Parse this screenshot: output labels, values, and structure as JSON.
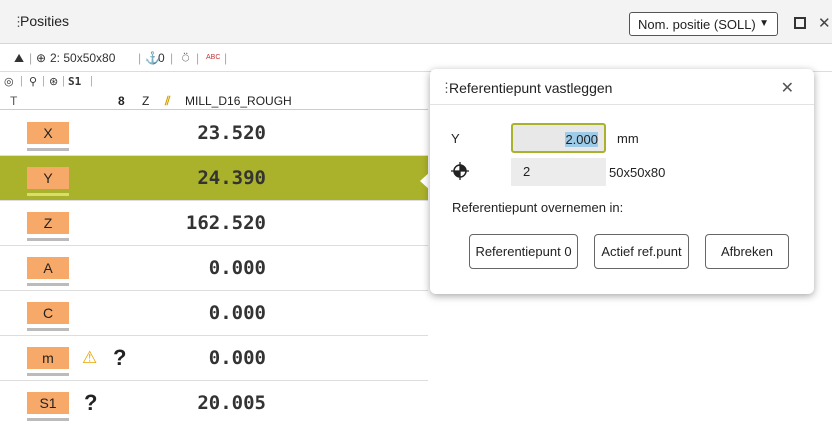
{
  "window": {
    "title": "Posities",
    "view_select": "Nom. positie (SOLL)"
  },
  "toolbar1": {
    "workpiece": "2: 50x50x80",
    "preset": "0",
    "abc": "ABC"
  },
  "toolbar2": {
    "spindle": "S1"
  },
  "header": {
    "col_t": "T",
    "tool_number": "8",
    "axis": "Z",
    "tool_name": "MILL_D16_ROUGH"
  },
  "rows": [
    {
      "axis": "X",
      "value": "23.520"
    },
    {
      "axis": "Y",
      "value": "24.390"
    },
    {
      "axis": "Z",
      "value": "162.520"
    },
    {
      "axis": "A",
      "value": "0.000"
    },
    {
      "axis": "C",
      "value": "0.000"
    },
    {
      "axis": "m",
      "value": "0.000",
      "marker": "?"
    },
    {
      "axis": "S1",
      "value": "20.005",
      "marker": "?"
    }
  ],
  "dialog": {
    "title": "Referentiepunt vastleggen",
    "axis_label": "Y",
    "input_value": "2.000",
    "unit": "mm",
    "preset_number": "2",
    "preset_name": "50x50x80",
    "apply_label": "Referentiepunt overnemen in:",
    "buttons": {
      "ref0": "Referentiepunt 0",
      "active": "Actief ref.punt",
      "cancel": "Afbreken"
    }
  },
  "colors": {
    "accent": "#aab12a",
    "axis_badge": "#f7a96a",
    "warning": "#e6a500"
  }
}
